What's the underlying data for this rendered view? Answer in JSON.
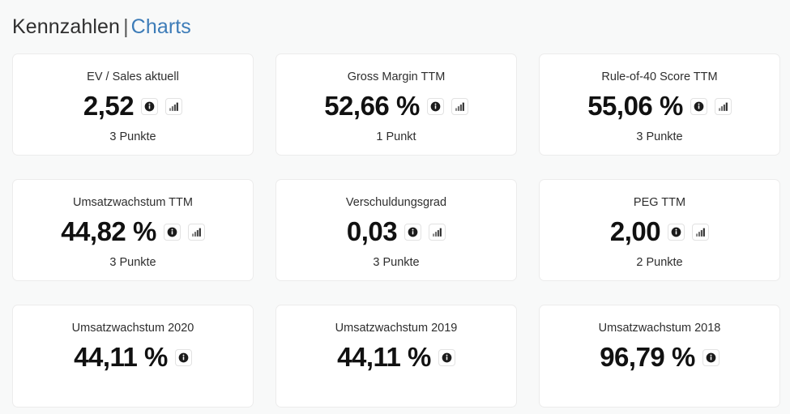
{
  "header": {
    "title": "Kennzahlen",
    "separator": "|",
    "charts_link": "Charts"
  },
  "icons": {
    "info": "info-circle-icon",
    "chart": "bar-chart-icon"
  },
  "colors": {
    "page_background": "#f8f9f9",
    "card_background": "#ffffff",
    "card_border": "#ececec",
    "link_blue": "#3d7cb8",
    "text_primary": "#2e2e2e",
    "value_text": "#111111"
  },
  "cards": [
    {
      "title": "EV / Sales aktuell",
      "value": "2,52",
      "points": "3 Punkte",
      "has_info_icon": true,
      "has_chart_icon": true
    },
    {
      "title": "Gross Margin TTM",
      "value": "52,66 %",
      "points": "1 Punkt",
      "has_info_icon": true,
      "has_chart_icon": true
    },
    {
      "title": "Rule-of-40 Score TTM",
      "value": "55,06 %",
      "points": "3 Punkte",
      "has_info_icon": true,
      "has_chart_icon": true
    },
    {
      "title": "Umsatzwachstum TTM",
      "value": "44,82 %",
      "points": "3 Punkte",
      "has_info_icon": true,
      "has_chart_icon": true
    },
    {
      "title": "Verschuldungsgrad",
      "value": "0,03",
      "points": "3 Punkte",
      "has_info_icon": true,
      "has_chart_icon": true
    },
    {
      "title": "PEG TTM",
      "value": "2,00",
      "points": "2 Punkte",
      "has_info_icon": true,
      "has_chart_icon": true
    },
    {
      "title": "Umsatzwachstum 2020",
      "value": "44,11 %",
      "points": "",
      "has_info_icon": true,
      "has_chart_icon": false
    },
    {
      "title": "Umsatzwachstum 2019",
      "value": "44,11 %",
      "points": "",
      "has_info_icon": true,
      "has_chart_icon": false
    },
    {
      "title": "Umsatzwachstum 2018",
      "value": "96,79 %",
      "points": "",
      "has_info_icon": true,
      "has_chart_icon": false
    }
  ]
}
